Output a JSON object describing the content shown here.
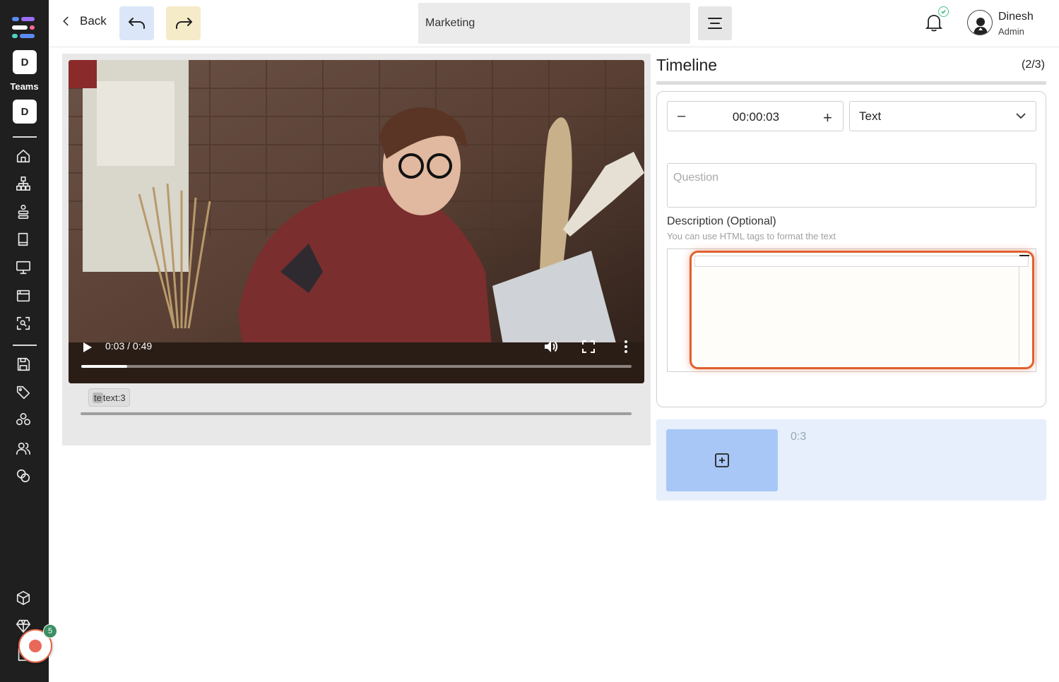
{
  "sidebar": {
    "workspace_initial": "D",
    "teams_label": "Teams",
    "team_initial": "D",
    "nav_icons": [
      "home-icon",
      "org-chart-icon",
      "stack-icon",
      "book-icon",
      "monitor-icon",
      "browser-window-icon",
      "scan-icon",
      "save-icon",
      "tag-icon",
      "cubes-icon",
      "users-icon",
      "coins-icon",
      "package-icon",
      "diamond-icon"
    ],
    "record_badge_count": "5",
    "colors": {
      "background": "#1f1f1f",
      "record": "#e8695a",
      "badge": "#3a8f63"
    }
  },
  "topbar": {
    "back_label": "Back",
    "title_value": "Marketing",
    "user_name": "Dinesh",
    "user_role": "Admin"
  },
  "video": {
    "current_time": "0:03",
    "duration": "0:49",
    "time_display": "0:03 / 0:49",
    "progress": 0.083,
    "marker_lead": "te",
    "marker_text": " text:3"
  },
  "timeline": {
    "title": "Timeline",
    "count": "(2/3)",
    "time_value": "00:00:03",
    "minus_label": "–",
    "plus_label": "+",
    "type_selected": "Text",
    "question_placeholder": "Question",
    "description_label": "Description (Optional)",
    "description_hint": "You can use HTML tags to format the text",
    "add_item_time": "0:3",
    "colors": {
      "focus_border": "#e0602f",
      "add_area": "#e6effb",
      "add_button": "#a9c7f6"
    }
  }
}
